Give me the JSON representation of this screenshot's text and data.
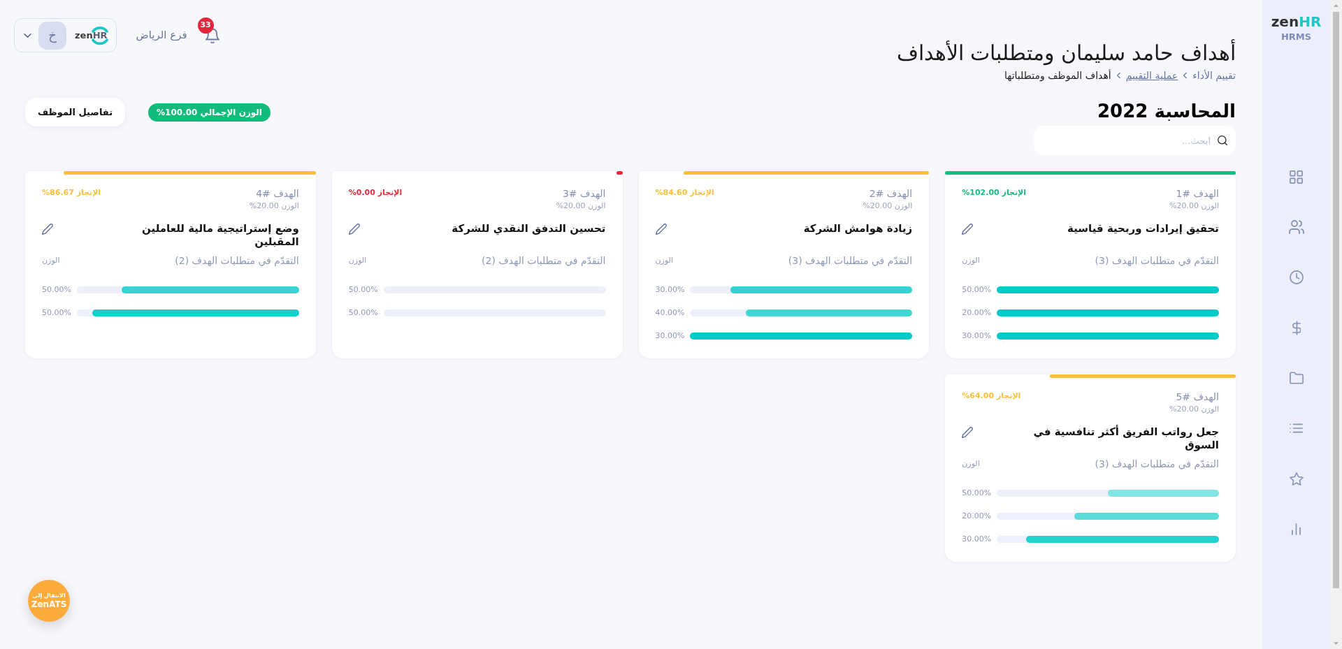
{
  "sidebar": {
    "logo": {
      "text": "zen",
      "accent": "HR",
      "subtitle": "HRMS"
    }
  },
  "header": {
    "notification_count": "33",
    "branch": "فرع الرياض",
    "company_logo": {
      "text": "zen",
      "accent": "HR"
    },
    "user_initial": "خ"
  },
  "page": {
    "title": "أهداف حامد سليمان ومتطلبات الأهداف",
    "breadcrumb": [
      {
        "label": "تقييم الأداء",
        "kind": "link"
      },
      {
        "label": "عملية التقييم",
        "kind": "underlined"
      },
      {
        "label": "أهداف الموظف ومتطلباتها",
        "kind": "current"
      }
    ],
    "section_title": "المحاسبة 2022",
    "search": {
      "placeholder": "ابحث..."
    },
    "total_weight": "الوزن الإجمالي 100.00%",
    "employee_details_button": "تفاصيل الموظف"
  },
  "goals": [
    {
      "number": "الهدف #1",
      "weight": "الوزن 20.00%",
      "achievement": "الإنجاز 102.00%",
      "level": 1,
      "color": "#13bd7d",
      "title": "تحقيق إيرادات وربحية قياسية",
      "progress_label": "التقدّم في متطلبات الهدف (3)",
      "weight_header": "الوزن",
      "requirements": [
        {
          "weight": "50.00%",
          "level": 1
        },
        {
          "weight": "20.00%",
          "level": 1
        },
        {
          "weight": "30.00%",
          "level": 1
        }
      ]
    },
    {
      "number": "الهدف #2",
      "weight": "الوزن 20.00%",
      "achievement": "الإنجاز 84.60%",
      "level": 0.846,
      "color": "#fbbf3c",
      "title": "زيادة هوامش الشركة",
      "progress_label": "التقدّم في متطلبات الهدف (3)",
      "weight_header": "الوزن",
      "requirements": [
        {
          "weight": "30.00%",
          "level": 0.82
        },
        {
          "weight": "40.00%",
          "level": 0.75
        },
        {
          "weight": "30.00%",
          "level": 1
        }
      ]
    },
    {
      "number": "الهدف #3",
      "weight": "الوزن 20.00%",
      "achievement": "الإنجاز 0.00%",
      "level": 0,
      "color": "#e5293c",
      "title": "تحسين التدفق النقدي للشركة",
      "progress_label": "التقدّم في متطلبات الهدف (2)",
      "weight_header": "الوزن",
      "requirements": [
        {
          "weight": "50.00%",
          "level": 0
        },
        {
          "weight": "50.00%",
          "level": 0
        }
      ]
    },
    {
      "number": "الهدف #4",
      "weight": "الوزن 20.00%",
      "achievement": "الإنجاز 86.67%",
      "level": 0.8667,
      "color": "#fbbf3c",
      "title": "وضع إستراتيجية مالية للعاملين المقبلين",
      "progress_label": "التقدّم في متطلبات الهدف (2)",
      "weight_header": "الوزن",
      "requirements": [
        {
          "weight": "50.00%",
          "level": 0.8
        },
        {
          "weight": "50.00%",
          "level": 0.93
        }
      ]
    },
    {
      "number": "الهدف #5",
      "weight": "الوزن 20.00%",
      "achievement": "الإنجاز 64.00%",
      "level": 0.64,
      "color": "#fbbf3c",
      "title": "جعل رواتب الفريق أكثر تنافسية في السوق",
      "progress_label": "التقدّم في متطلبات الهدف (3)",
      "weight_header": "الوزن",
      "requirements": [
        {
          "weight": "50.00%",
          "level": 0.5
        },
        {
          "weight": "20.00%",
          "level": 0.65
        },
        {
          "weight": "30.00%",
          "level": 0.87
        }
      ]
    }
  ],
  "zenats_button": {
    "line_1": "الانتقال إلى",
    "line_2": "ZenATS"
  }
}
